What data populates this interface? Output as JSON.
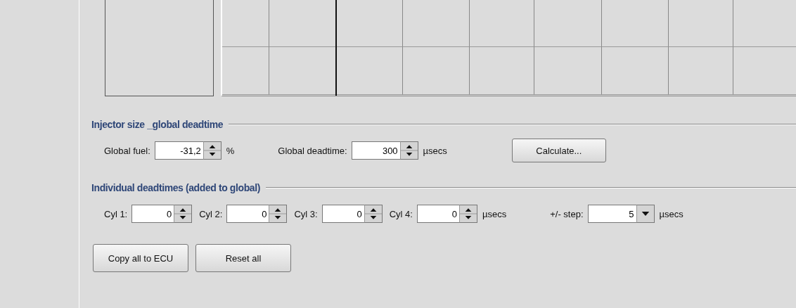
{
  "sections": [
    {
      "title": "Injector size _global deadtime",
      "fields": [
        {
          "kind": "spinner",
          "label": "Global fuel:",
          "value": "-31,2",
          "unit": "%"
        },
        {
          "kind": "spinner",
          "label": "Global deadtime:",
          "value": "300",
          "unit": "µsecs"
        },
        {
          "kind": "button",
          "label": "Calculate..."
        }
      ]
    },
    {
      "title": "Individual deadtimes (added to global)",
      "fields": [
        {
          "kind": "spinner",
          "label": "Cyl 1:",
          "value": "0"
        },
        {
          "kind": "spinner",
          "label": "Cyl 2:",
          "value": "0"
        },
        {
          "kind": "spinner",
          "label": "Cyl 3:",
          "value": "0"
        },
        {
          "kind": "spinner",
          "label": "Cyl 4:",
          "value": "0",
          "unit": "µsecs"
        },
        {
          "kind": "combo",
          "label": "+/- step:",
          "value": "5",
          "unit": "µsecs"
        }
      ]
    }
  ],
  "buttons": [
    "Copy all to ECU",
    "Reset all"
  ]
}
